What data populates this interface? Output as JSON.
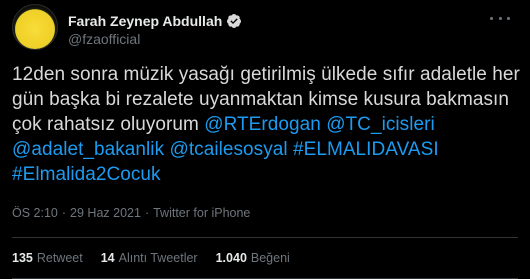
{
  "author": {
    "display_name": "Farah Zeynep Abdullah",
    "handle": "@fzaofficial",
    "verified": true,
    "avatar_color": "#f2d22a"
  },
  "tweet": {
    "segments": [
      {
        "type": "text",
        "text": "12den sonra müzik yasağı getirilmiş ülkede sıfır adaletle her gün başka bi rezalete uyanmaktan kimse kusura bakmasın çok rahatsız oluyorum "
      },
      {
        "type": "mention",
        "text": "@RTErdogan"
      },
      {
        "type": "text",
        "text": " "
      },
      {
        "type": "mention",
        "text": "@TC_icisleri"
      },
      {
        "type": "text",
        "text": " "
      },
      {
        "type": "mention",
        "text": "@adalet_bakanlik"
      },
      {
        "type": "text",
        "text": " "
      },
      {
        "type": "mention",
        "text": "@tcailesosyal"
      },
      {
        "type": "text",
        "text": " "
      },
      {
        "type": "hashtag",
        "text": "#ELMALIDAVASI"
      },
      {
        "type": "text",
        "text": " "
      },
      {
        "type": "hashtag",
        "text": "#Elmalida2Cocuk"
      }
    ]
  },
  "meta": {
    "time": "ÖS 2:10",
    "separator": "·",
    "date": "29 Haz 2021",
    "source": "Twitter for iPhone"
  },
  "stats": {
    "retweets_count": "135",
    "retweets_label": "Retweet",
    "quotes_count": "14",
    "quotes_label": "Alıntı Tweetler",
    "likes_count": "1.040",
    "likes_label": "Beğeni"
  },
  "colors": {
    "background": "#000000",
    "link": "#1d9bf0",
    "muted": "#6e767d",
    "verified": "#d9d9d9"
  }
}
